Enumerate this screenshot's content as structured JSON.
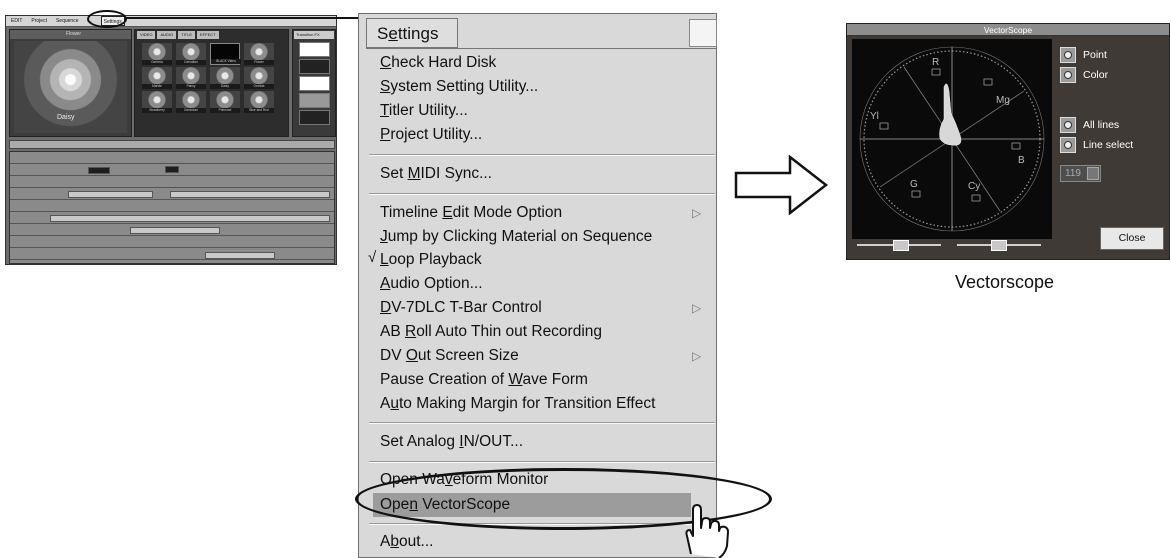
{
  "editor": {
    "menubar": [
      "EDIT",
      "Project",
      "Sequence",
      "...",
      "Settings"
    ],
    "monitor_title": "Flower",
    "monitor_caption": "Daisy",
    "bin_tabs": [
      "VIDEO",
      "AUDIO",
      "TITLE",
      "EFFECT"
    ],
    "thumbnails": [
      "Gerbera",
      "Carnation",
      "BLACK Video",
      "Flower",
      "Marble",
      "Pansy",
      "Daisy",
      "Orchids",
      "Strawberry",
      "Geranium",
      "Primrose",
      "Blue and Red"
    ],
    "fx_title": "Transition FX"
  },
  "menu": {
    "title": "Settings",
    "items": [
      {
        "label": "Check Hard Disk",
        "ul": "C"
      },
      {
        "label": "System Setting Utility...",
        "ul": "S"
      },
      {
        "label": "Titler Utility...",
        "ul": "T"
      },
      {
        "label": "Project Utility...",
        "ul": "P"
      },
      {
        "label": "Set MIDI Sync...",
        "ul": "M"
      },
      {
        "label": "Timeline Edit Mode Option",
        "ul": "E",
        "submenu": true
      },
      {
        "label": "Jump by Clicking Material on Sequence",
        "ul": "J"
      },
      {
        "label": "Loop Playback",
        "ul": "L",
        "checked": true
      },
      {
        "label": "Audio Option...",
        "ul": "A"
      },
      {
        "label": "DV-7DLC T-Bar Control",
        "ul": "D",
        "submenu": true
      },
      {
        "label": "AB Roll Auto Thin out Recording",
        "ul": "R"
      },
      {
        "label": "DV Out Screen Size",
        "ul": "O",
        "submenu": true
      },
      {
        "label": "Pause Creation of Wave Form",
        "ul": "W"
      },
      {
        "label": "Auto Making Margin for Transition Effect",
        "ul": "u"
      },
      {
        "label": "Set Analog IN/OUT...",
        "ul": "I"
      },
      {
        "label": "Open Waveform Monitor",
        "ul": "v"
      },
      {
        "label": "Open VectorScope",
        "ul": "n",
        "highlighted": true
      },
      {
        "label": "About...",
        "ul": "b"
      }
    ],
    "check_mark": "√",
    "submenu_arrow": "▷"
  },
  "vectorscope": {
    "title": "VectorScope",
    "options": [
      "Point",
      "Color",
      "All lines",
      "Line select"
    ],
    "line_number": "119",
    "close_label": "Close",
    "targets": [
      "R",
      "Mg",
      "B",
      "Cy",
      "G",
      "Yl"
    ],
    "caption": "Vectorscope"
  },
  "icons": {
    "arrow": "right-arrow-outline-icon",
    "hand": "pointing-hand-icon",
    "stepper": "spin-stepper-icon"
  },
  "colors": {
    "menu_bg": "#d9d9d9",
    "menu_highlight": "#9c9c9c",
    "scope_bg": "#0a0a0a",
    "window_bg": "#3f3a35"
  }
}
